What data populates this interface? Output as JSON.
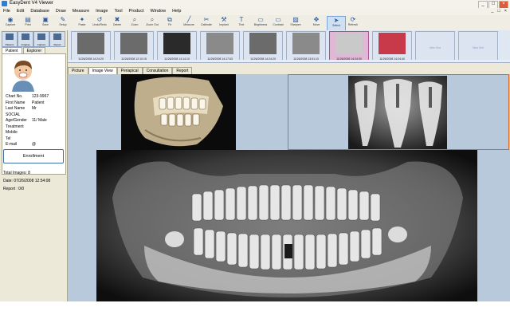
{
  "window": {
    "title": "EasyDent V4 Viewer",
    "minimize": "_",
    "maximize": "□",
    "close": "×"
  },
  "menu": {
    "items": [
      "File",
      "Edit",
      "Database",
      "Draw",
      "Measure",
      "Image",
      "Tool",
      "Product",
      "Window",
      "Help"
    ],
    "mdi": [
      "_",
      "□",
      "×"
    ]
  },
  "toolbar": {
    "items": [
      {
        "label": "Capture",
        "icon": "camera-icon",
        "glyph": "◉"
      },
      {
        "label": "Print",
        "icon": "print-icon",
        "glyph": "▤"
      },
      {
        "label": "Save",
        "icon": "save-icon",
        "glyph": "▣"
      },
      {
        "label": "Setup",
        "icon": "tools-icon",
        "glyph": "✎"
      },
      {
        "label": "Paste",
        "icon": "paste-icon",
        "glyph": "✦"
      },
      {
        "label": "Undo/Redo",
        "icon": "undo-icon",
        "glyph": "↺"
      },
      {
        "label": "Delete",
        "icon": "delete-icon",
        "glyph": "✖"
      },
      {
        "label": "Zoom",
        "icon": "zoom-icon",
        "glyph": "⌕"
      },
      {
        "label": "Zoom Out",
        "icon": "zoom-out-icon",
        "glyph": "⌕"
      },
      {
        "label": "Fit",
        "icon": "fit-icon",
        "glyph": "⧉"
      },
      {
        "label": "Measure",
        "icon": "measure-icon",
        "glyph": "╱"
      },
      {
        "label": "Calibrate",
        "icon": "calibrate-icon",
        "glyph": "✂"
      },
      {
        "label": "Implant",
        "icon": "implant-icon",
        "glyph": "⚒"
      },
      {
        "label": "Text",
        "icon": "text-icon",
        "glyph": "T"
      },
      {
        "label": "Brightness",
        "icon": "brightness-icon",
        "glyph": "▭"
      },
      {
        "label": "Contrast",
        "icon": "contrast-icon",
        "glyph": "▭"
      },
      {
        "label": "Sharpen",
        "icon": "sharpen-icon",
        "glyph": "▨"
      },
      {
        "label": "Move",
        "icon": "move-icon",
        "glyph": "✥"
      },
      {
        "label": "Select",
        "icon": "select-icon",
        "glyph": "➤"
      },
      {
        "label": "Refresh",
        "icon": "refresh-icon",
        "glyph": "⟳"
      }
    ]
  },
  "mode_buttons": [
    "Patients",
    "Imaging",
    "Capture",
    "Report"
  ],
  "patient": {
    "tabs": [
      "Patient",
      "Explorer"
    ],
    "fields": [
      {
        "k": "Chart No.",
        "v": "123-9967"
      },
      {
        "k": "First Name",
        "v": "Patient"
      },
      {
        "k": "Last Name",
        "v": "Mr"
      },
      {
        "k": "SOCIAL",
        "v": ""
      },
      {
        "k": "Age/Gender",
        "v": "11/ Male"
      },
      {
        "k": "Treatment",
        "v": ""
      },
      {
        "k": "Mobile",
        "v": ""
      },
      {
        "k": "Tel",
        "v": ""
      },
      {
        "k": "E-mail",
        "v": "@"
      }
    ],
    "enroll_label": "Enrollment",
    "meta": [
      "Total Images: 8",
      "Date: 07/26/2008 12:54:08",
      "Report : 0/0"
    ]
  },
  "thumbnails": [
    {
      "cap": "11/26/2008 14:24:20",
      "kind": "pano"
    },
    {
      "cap": "11/26/2008 12:10:15",
      "kind": "pano"
    },
    {
      "cap": "11/26/2008 14:14:10",
      "kind": "ct"
    },
    {
      "cap": "11/26/2008 14:17:53",
      "kind": "xray"
    },
    {
      "cap": "11/26/2008 14:24:20",
      "kind": "pano"
    },
    {
      "cap": "11/26/2008 13:51:10",
      "kind": "xray"
    },
    {
      "cap": "11/26/2008 14:24:30",
      "kind": "sel"
    },
    {
      "cap": "11/26/2008 14:24:40",
      "kind": "photo"
    },
    {
      "cap": "New Slot",
      "kind": "empty"
    },
    {
      "cap": "New Slot",
      "kind": "empty"
    }
  ],
  "view_tabs": [
    "Picture",
    "Image View",
    "Periapical",
    "Consultation",
    "Report"
  ],
  "colors": {
    "accent": "#3d6fa6",
    "selection": "#d06b2a",
    "viewer_bg": "#b9c9dc"
  }
}
